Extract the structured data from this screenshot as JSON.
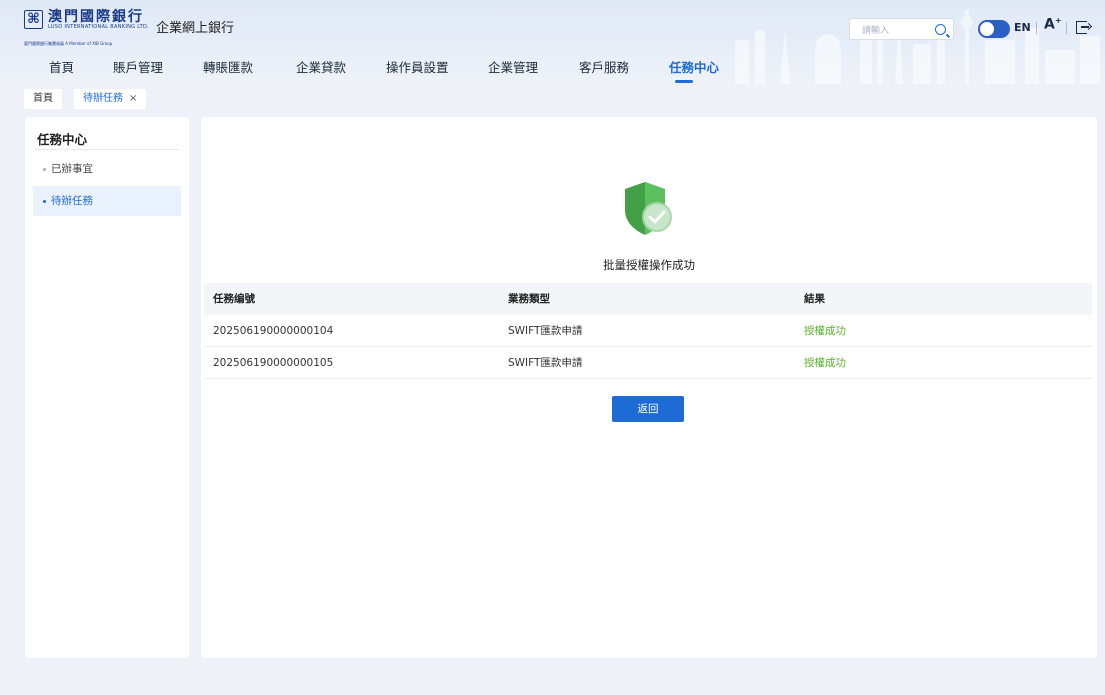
{
  "brand": {
    "name_cn": "澳門國際銀行",
    "name_en": "LUSO INTERNATIONAL BANKING LTD.",
    "group_line": "廈門國際銀行集團成員 A Member of XIB Group",
    "logo_glyph": "⌘",
    "portal_title": "企業網上銀行"
  },
  "header": {
    "search_placeholder": "請輸入",
    "language": "EN",
    "font_size_label": "A",
    "font_size_sup": "+"
  },
  "nav": {
    "items": [
      {
        "label": "首頁"
      },
      {
        "label": "賬戶管理"
      },
      {
        "label": "轉賬匯款"
      },
      {
        "label": "企業貸款"
      },
      {
        "label": "操作員設置"
      },
      {
        "label": "企業管理"
      },
      {
        "label": "客戶服務"
      },
      {
        "label": "任務中心"
      }
    ],
    "active": "任務中心"
  },
  "crumbs": {
    "home": "首頁",
    "current": "待辦任務",
    "close_glyph": "×"
  },
  "sidebar": {
    "title": "任務中心",
    "items": [
      {
        "label": "已辦事宜"
      },
      {
        "label": "待辦任務"
      }
    ],
    "active": "待辦任務"
  },
  "result": {
    "message": "批量授權操作成功",
    "columns": [
      "任務编號",
      "業務類型",
      "結果"
    ],
    "rows": [
      {
        "task_no": "202506190000000104",
        "type": "SWIFT匯款申請",
        "status": "授權成功"
      },
      {
        "task_no": "202506190000000105",
        "type": "SWIFT匯款申請",
        "status": "授權成功"
      }
    ],
    "back_label": "返回"
  },
  "colors": {
    "accent": "#1e6bd6",
    "success": "#5ab12e",
    "shield": "#4caf50"
  }
}
